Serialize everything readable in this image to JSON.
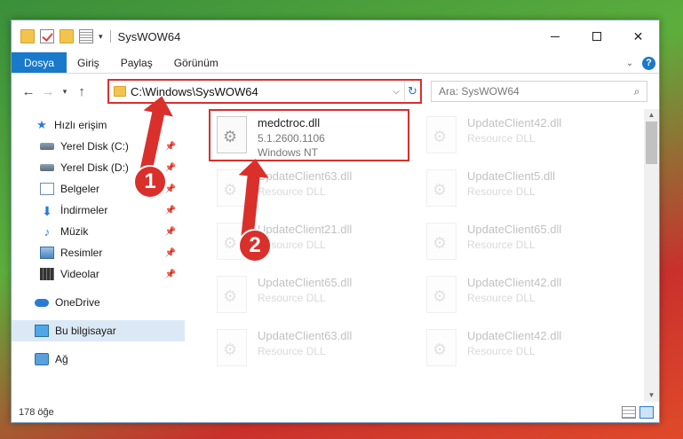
{
  "window": {
    "title": "SysWOW64"
  },
  "ribbon": {
    "tabs": [
      "Dosya",
      "Giriş",
      "Paylaş",
      "Görünüm"
    ],
    "help": "?"
  },
  "address": {
    "path": "C:\\Windows\\SysWOW64"
  },
  "search": {
    "placeholder": "Ara: SysWOW64"
  },
  "sidebar": {
    "quick_access": "Hızlı erişim",
    "items": [
      {
        "label": "Yerel Disk (C:)",
        "icon": "drive-icon"
      },
      {
        "label": "Yerel Disk (D:)",
        "icon": "drive-icon"
      },
      {
        "label": "Belgeler",
        "icon": "documents-icon"
      },
      {
        "label": "İndirmeler",
        "icon": "downloads-icon"
      },
      {
        "label": "Müzik",
        "icon": "music-icon"
      },
      {
        "label": "Resimler",
        "icon": "pictures-icon"
      },
      {
        "label": "Videolar",
        "icon": "videos-icon"
      }
    ],
    "onedrive": "OneDrive",
    "this_pc": "Bu bilgisayar",
    "network": "Ağ"
  },
  "files": {
    "selected": {
      "name": "medctroc.dll",
      "version": "5.1.2600.1106",
      "desc": "Windows NT"
    },
    "background": [
      {
        "name": "UpdateClient42.dll",
        "desc": "Resource DLL"
      },
      {
        "name": "UpdateClient63.dll",
        "desc": "Resource DLL"
      },
      {
        "name": "UpdateClient5.dll",
        "desc": "Resource DLL"
      },
      {
        "name": "UpdateClient21.dll",
        "desc": "Resource DLL"
      },
      {
        "name": "UpdateClient65.dll",
        "desc": "Resource DLL"
      },
      {
        "name": "UpdateClient65.dll",
        "desc": "Resource DLL"
      },
      {
        "name": "UpdateClient42.dll",
        "desc": "Resource DLL"
      },
      {
        "name": "UpdateClient63.dll",
        "desc": "Resource DLL"
      },
      {
        "name": "UpdateClient42.dll",
        "desc": "Resource DLL"
      }
    ]
  },
  "status": {
    "count": "178 öğe"
  },
  "annotations": {
    "step1": "1",
    "step2": "2"
  },
  "colors": {
    "accent": "#1979ca",
    "highlight": "#d9302c"
  }
}
